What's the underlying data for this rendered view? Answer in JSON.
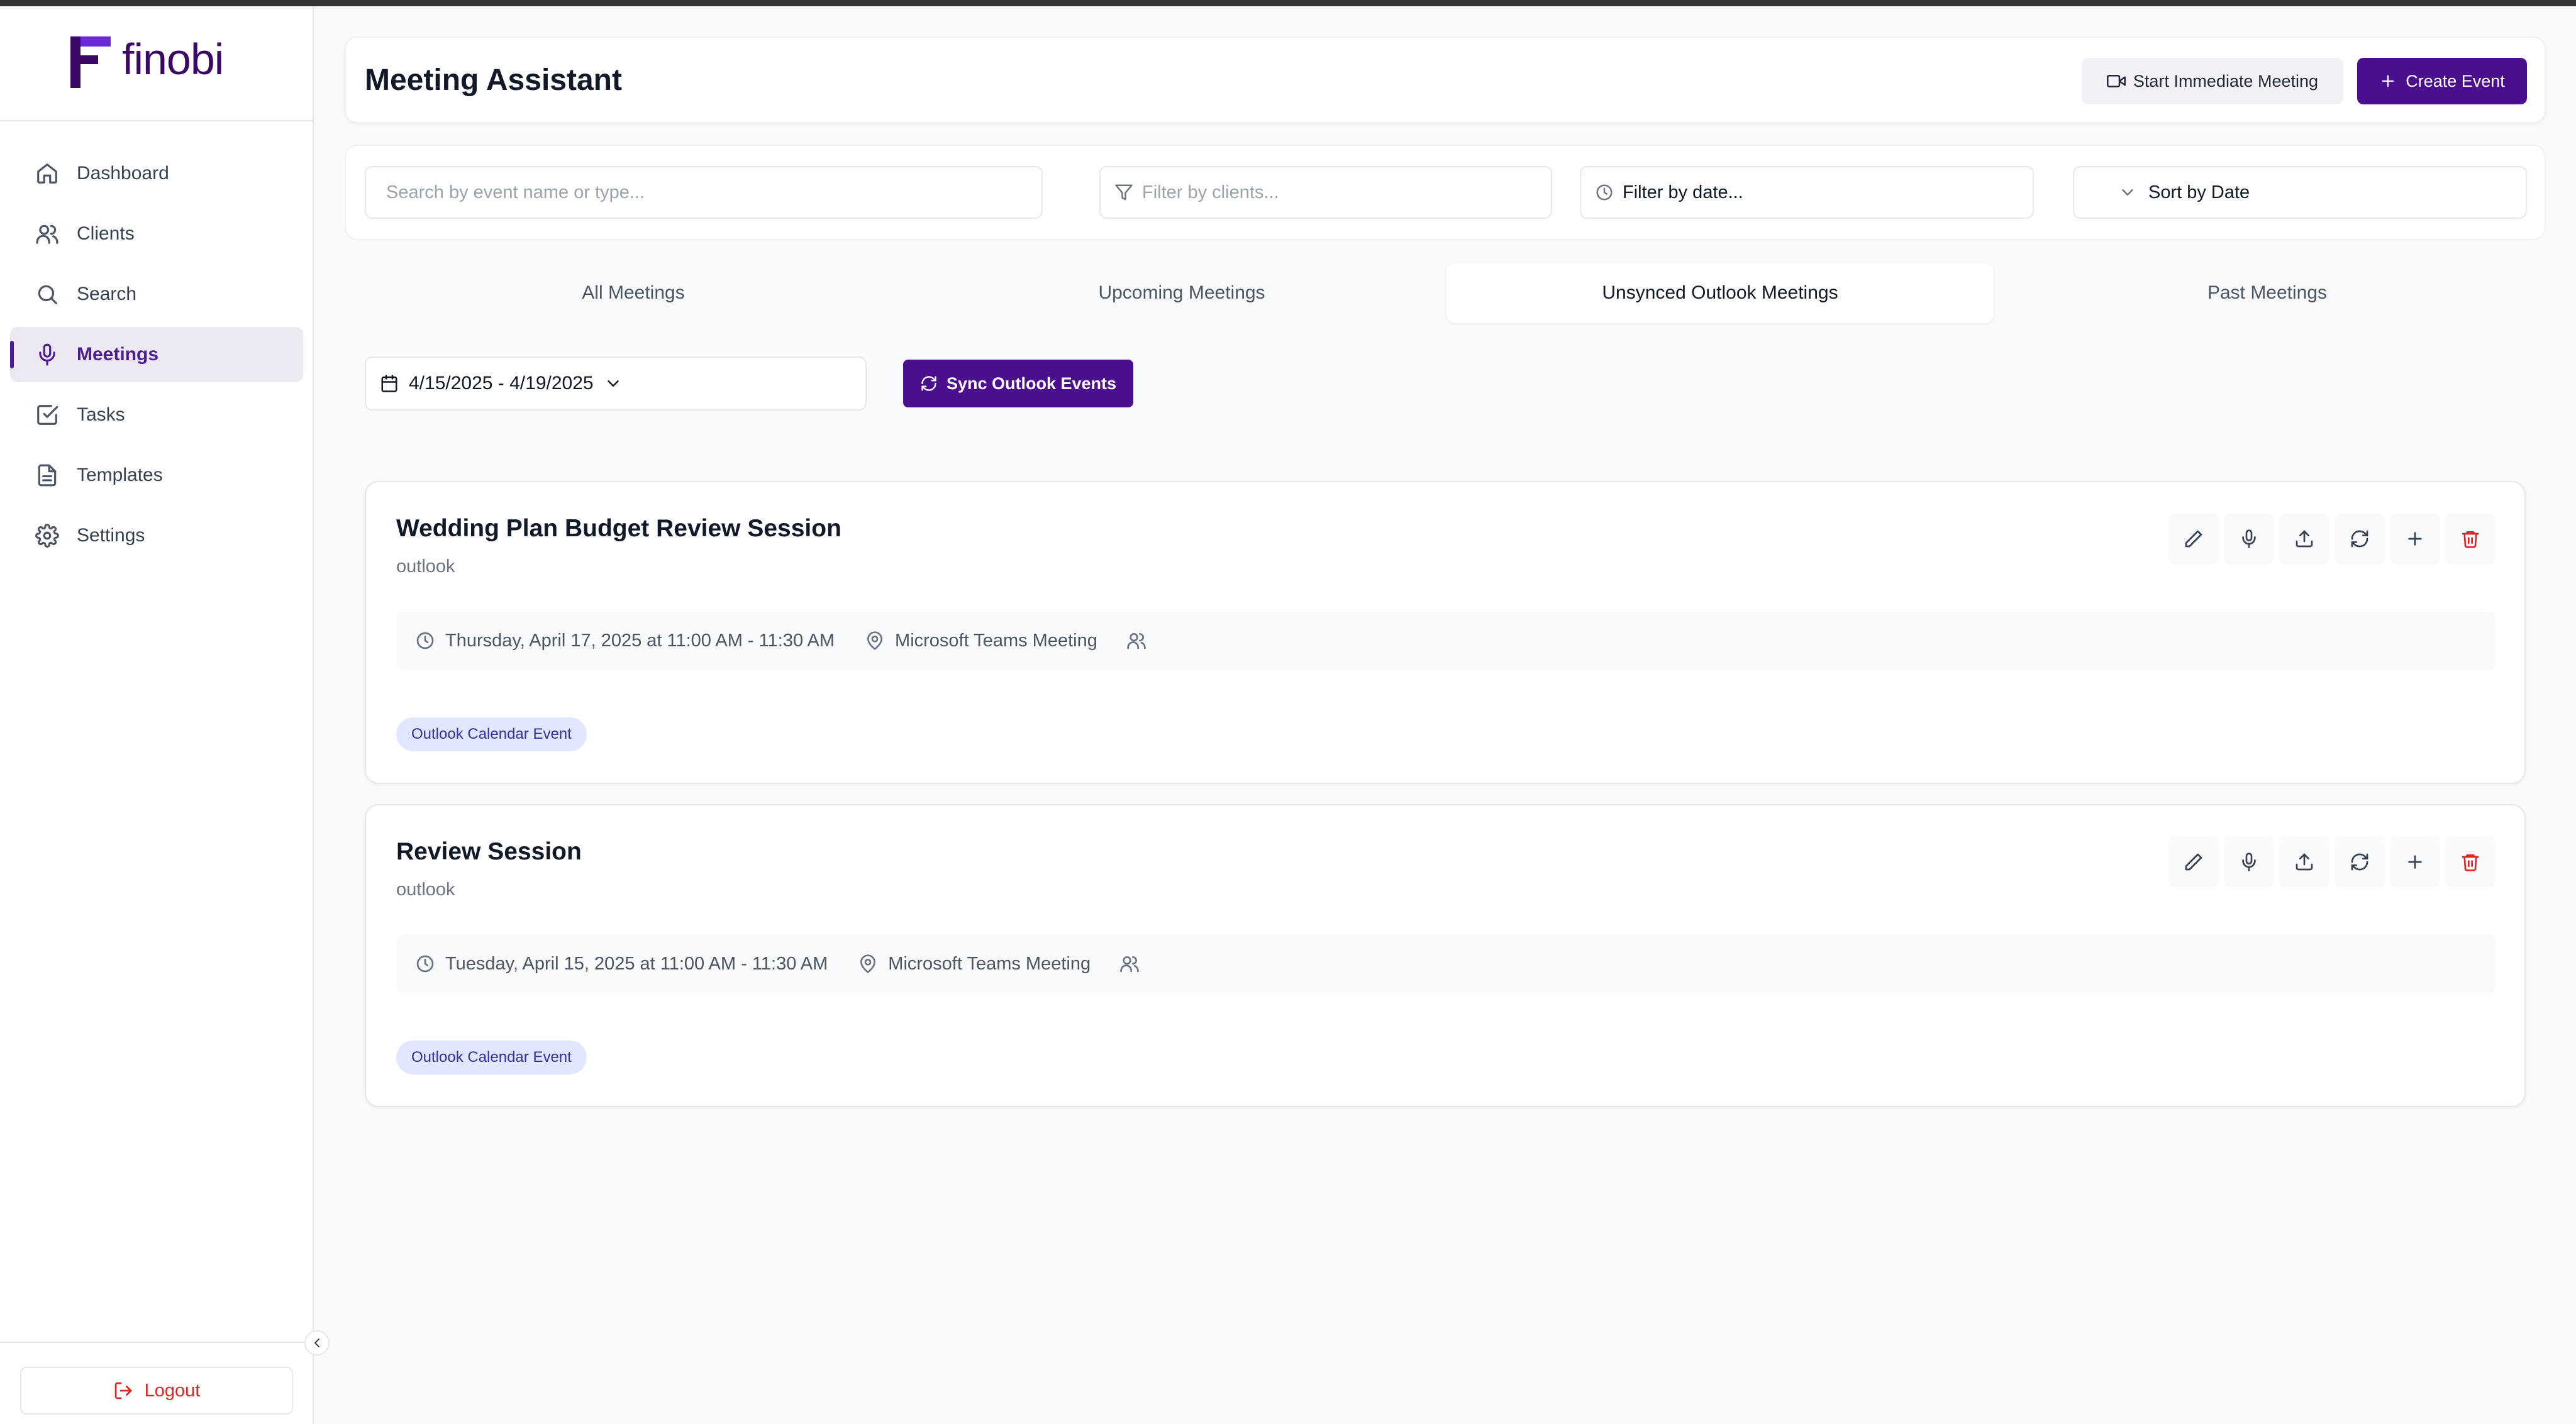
{
  "brand": {
    "name": "finobi"
  },
  "sidebar": {
    "items": [
      {
        "label": "Dashboard",
        "icon": "home-icon"
      },
      {
        "label": "Clients",
        "icon": "users-icon"
      },
      {
        "label": "Search",
        "icon": "search-icon"
      },
      {
        "label": "Meetings",
        "icon": "microphone-icon",
        "active": true
      },
      {
        "label": "Tasks",
        "icon": "checkbox-icon"
      },
      {
        "label": "Templates",
        "icon": "document-icon"
      },
      {
        "label": "Settings",
        "icon": "gear-icon"
      }
    ],
    "logout_label": "Logout"
  },
  "header": {
    "title": "Meeting Assistant",
    "start_meeting_label": "Start Immediate Meeting",
    "create_event_label": "Create Event"
  },
  "filters": {
    "search_placeholder": "Search by event name or type...",
    "clients_placeholder": "Filter by clients...",
    "date_label": "Filter by date...",
    "sort_label": "Sort by Date"
  },
  "tabs": [
    {
      "label": "All Meetings"
    },
    {
      "label": "Upcoming Meetings"
    },
    {
      "label": "Unsynced Outlook Meetings",
      "active": true
    },
    {
      "label": "Past Meetings"
    }
  ],
  "toolbar": {
    "date_range": "4/15/2025 - 4/19/2025",
    "sync_label": "Sync Outlook Events"
  },
  "meetings": [
    {
      "title": "Wedding Plan Budget Review Session",
      "source": "outlook",
      "when": "Thursday, April 17, 2025 at 11:00 AM - 11:30 AM",
      "location": "Microsoft Teams Meeting",
      "badge": "Outlook Calendar Event"
    },
    {
      "title": "Review Session",
      "source": "outlook",
      "when": "Tuesday, April 15, 2025 at 11:00 AM - 11:30 AM",
      "location": "Microsoft Teams Meeting",
      "badge": "Outlook Calendar Event"
    }
  ],
  "colors": {
    "brand_primary": "#4a0e8f",
    "active_nav_bg": "#ede9f3",
    "danger": "#dc2626",
    "badge_bg": "#e0e7ff",
    "badge_text": "#3730a3"
  }
}
